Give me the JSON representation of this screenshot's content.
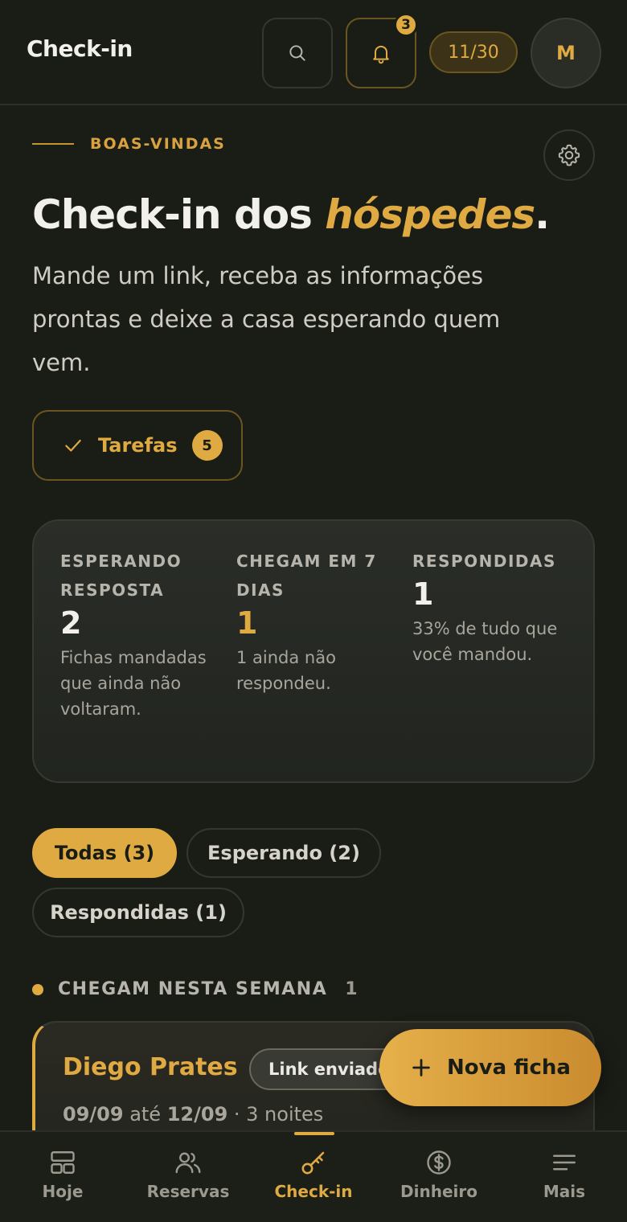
{
  "header": {
    "title": "Check-in",
    "notifications_count": "3",
    "usage": "11/30",
    "avatar_initial": "M"
  },
  "hero": {
    "eyebrow": "BOAS-VINDAS",
    "title_start": "Check-in dos ",
    "title_highlight": "hóspedes",
    "title_end": ".",
    "subtitle": "Mande um link, receba as informações prontas e deixe a casa esperando quem vem.",
    "tasks_label": "Tarefas",
    "tasks_count": "5"
  },
  "stats": [
    {
      "label": "ESPERANDO RESPOSTA",
      "value": "2",
      "description": "Fichas mandadas que ainda não voltaram."
    },
    {
      "label": "CHEGAM EM 7 DIAS",
      "value": "1",
      "description": "1 ainda não respondeu."
    },
    {
      "label": "RESPONDIDAS",
      "value": "1",
      "description": "33% de tudo que você mandou."
    }
  ],
  "filters": {
    "all": "Todas (3)",
    "waiting": "Esperando (2)",
    "answered": "Respondidas (1)"
  },
  "section": {
    "title": "CHEGAM NESTA SEMANA",
    "count": "1"
  },
  "guest": {
    "name": "Diego Prates",
    "status": "Link enviado",
    "date_from": "09/09",
    "date_sep": " até ",
    "date_to": "12/09",
    "nights": " · 3 noites"
  },
  "fab": {
    "label": "Nova ficha"
  },
  "nav": {
    "items": [
      {
        "label": "Hoje",
        "icon": "dashboard-icon"
      },
      {
        "label": "Reservas",
        "icon": "users-icon"
      },
      {
        "label": "Check-in",
        "icon": "key-icon",
        "active": true
      },
      {
        "label": "Dinheiro",
        "icon": "dollar-icon"
      },
      {
        "label": "Mais",
        "icon": "menu-icon"
      }
    ]
  },
  "colors": {
    "background": "#1a1d16",
    "accent": "#e0aa42"
  }
}
